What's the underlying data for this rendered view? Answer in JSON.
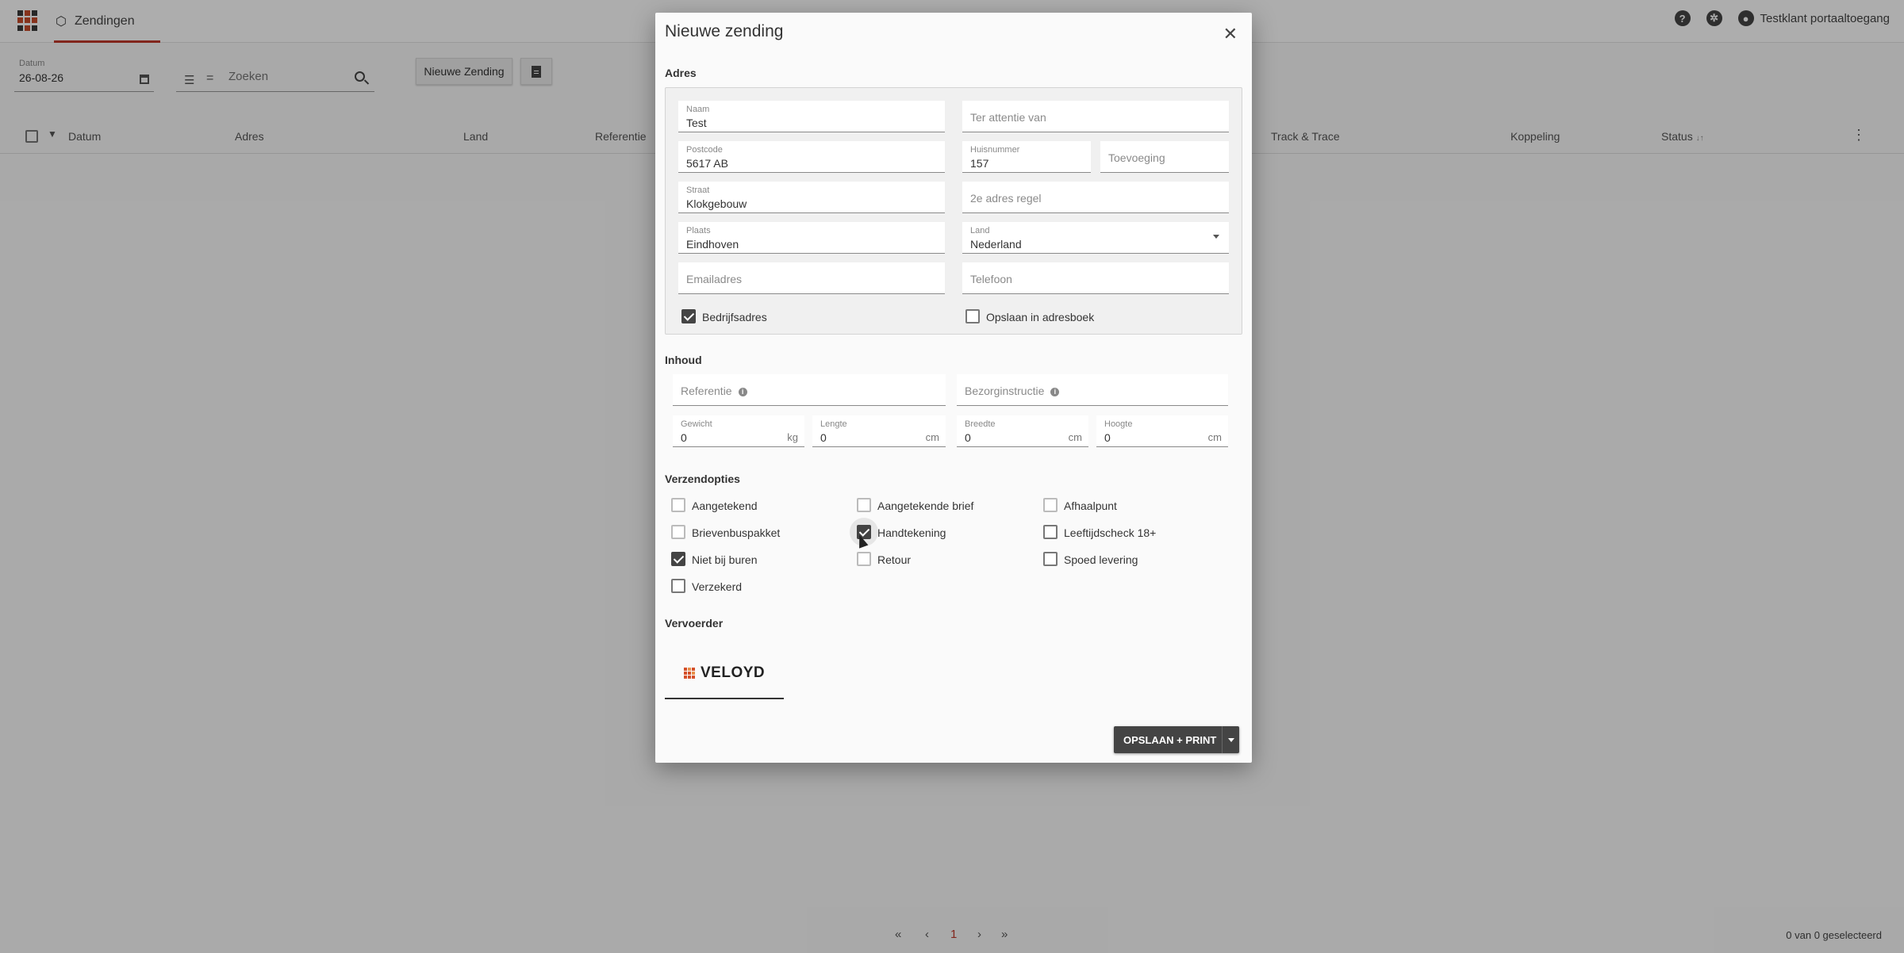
{
  "app": {
    "nav_tab": "Zendingen",
    "user_name": "Testklant portaaltoegang"
  },
  "toolbar": {
    "date_label": "Datum",
    "date_value": "26-08-26",
    "search_placeholder": "Zoeken",
    "new_button": "Nieuwe Zending"
  },
  "table": {
    "columns": [
      "Datum",
      "Adres",
      "Land",
      "Referentie",
      "Track & Trace",
      "Koppeling",
      "Status"
    ],
    "status_sort_glyph": "↓↑"
  },
  "pager": {
    "current_page": "1",
    "selection_count": "0 van 0 geselecteerd"
  },
  "dialog": {
    "title": "Nieuwe zending",
    "adres": {
      "section_title": "Adres",
      "naam_label": "Naam",
      "naam_value": "Test",
      "attentie_placeholder": "Ter attentie van",
      "postcode_label": "Postcode",
      "postcode_value": "5617 AB",
      "huisnummer_label": "Huisnummer",
      "huisnummer_value": "157",
      "toevoeging_placeholder": "Toevoeging",
      "straat_label": "Straat",
      "straat_value": "Klokgebouw",
      "adresregel2_placeholder": "2e adres regel",
      "plaats_label": "Plaats",
      "plaats_value": "Eindhoven",
      "land_label": "Land",
      "land_value": "Nederland",
      "email_placeholder": "Emailadres",
      "telefoon_placeholder": "Telefoon",
      "bedrijfsadres_label": "Bedrijfsadres",
      "bedrijfsadres_checked": true,
      "adresboek_label": "Opslaan in adresboek",
      "adresboek_checked": false
    },
    "inhoud": {
      "section_title": "Inhoud",
      "referentie_placeholder": "Referentie",
      "bezorginstructie_placeholder": "Bezorginstructie",
      "gewicht_label": "Gewicht",
      "gewicht_value": "0",
      "gewicht_unit": "kg",
      "lengte_label": "Lengte",
      "lengte_value": "0",
      "lengte_unit": "cm",
      "breedte_label": "Breedte",
      "breedte_value": "0",
      "breedte_unit": "cm",
      "hoogte_label": "Hoogte",
      "hoogte_value": "0",
      "hoogte_unit": "cm"
    },
    "verzendopties": {
      "section_title": "Verzendopties",
      "options": [
        {
          "label": "Aangetekend",
          "checked": false
        },
        {
          "label": "Aangetekende brief",
          "checked": false
        },
        {
          "label": "Afhaalpunt",
          "checked": false
        },
        {
          "label": "Brievenbuspakket",
          "checked": false
        },
        {
          "label": "Handtekening",
          "checked": true
        },
        {
          "label": "Leeftijdscheck 18+",
          "checked": false
        },
        {
          "label": "Niet bij buren",
          "checked": true
        },
        {
          "label": "Retour",
          "checked": false
        },
        {
          "label": "Spoed levering",
          "checked": false
        },
        {
          "label": "Verzekerd",
          "checked": false
        }
      ]
    },
    "vervoerder": {
      "section_title": "Vervoerder",
      "carrier_name": "VELOYD"
    },
    "save_button": "OPSLAAN + PRINT"
  }
}
